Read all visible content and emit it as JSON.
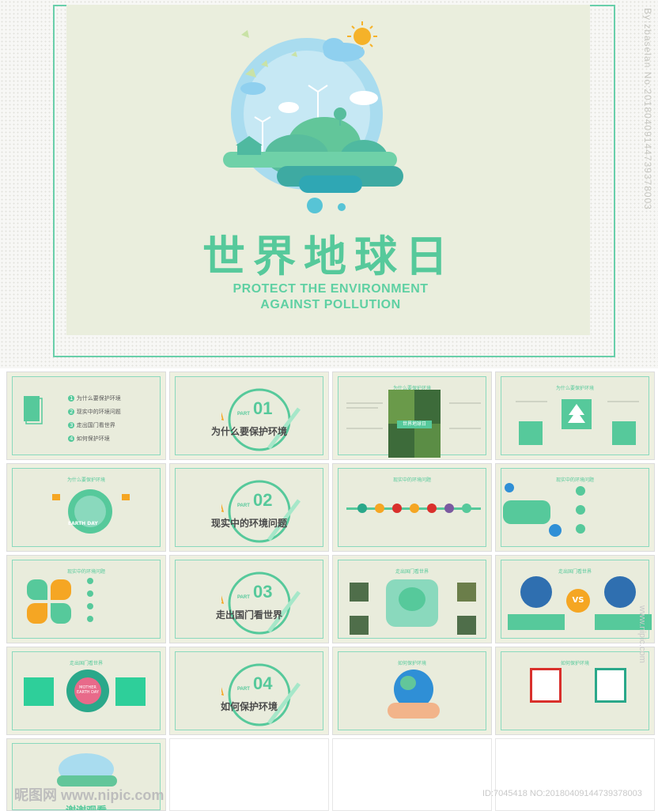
{
  "hero": {
    "title": "世界地球日",
    "subtitle_line1": "PROTECT THE ENVIRONMENT",
    "subtitle_line2": "AGAINST POLLUTION",
    "side_watermark": "By:zbaselan No:20180409144739378003"
  },
  "colors": {
    "accent_green": "#56c99b",
    "bg_beige": "#eaeedd",
    "frame_border": "#69cfaa",
    "orange": "#f5a623",
    "teal_dark": "#2aa88a",
    "red": "#d9302c"
  },
  "slides": {
    "s1": {
      "toc": [
        "为什么要保护环境",
        "现实中的环境问题",
        "走出国门看世界",
        "如何保护环境"
      ],
      "nums": [
        "1",
        "2",
        "3",
        "4"
      ]
    },
    "s2": {
      "part": "PART",
      "num": "01",
      "title": "为什么要保护环境"
    },
    "s3": {
      "head": "为什么要保护环境",
      "center_label": "世界地球日"
    },
    "s4": {
      "head": "为什么要保护环境"
    },
    "s5": {
      "head": "为什么要保护环境",
      "badge": "EARTH DAY"
    },
    "s6": {
      "part": "PART",
      "num": "02",
      "title": "现实中的环境问题"
    },
    "s7": {
      "head": "现实中的环境问题"
    },
    "s8": {
      "head": "现实中的环境问题"
    },
    "s9": {
      "head": "现实中的环境问题"
    },
    "s10": {
      "part": "PART",
      "num": "03",
      "title": "走出国门看世界"
    },
    "s11": {
      "head": "走出国门看世界"
    },
    "s12": {
      "head": "走出国门看世界",
      "vs": "VS"
    },
    "s13": {
      "head": "走出国门看世界",
      "badge": "MOTHER EARTH DAY"
    },
    "s14": {
      "part": "PART",
      "num": "04",
      "title": "如何保护环境"
    },
    "s15": {
      "head": "如何保护环境"
    },
    "s16": {
      "head": "如何保护环境"
    },
    "s17": {
      "title": "谢谢观看"
    }
  },
  "footer": {
    "left_wm": "昵图网 www.nipic.com",
    "right_wm": "ID:7045418 NO:20180409144739378003",
    "side_wm": "www.nipic.com"
  }
}
